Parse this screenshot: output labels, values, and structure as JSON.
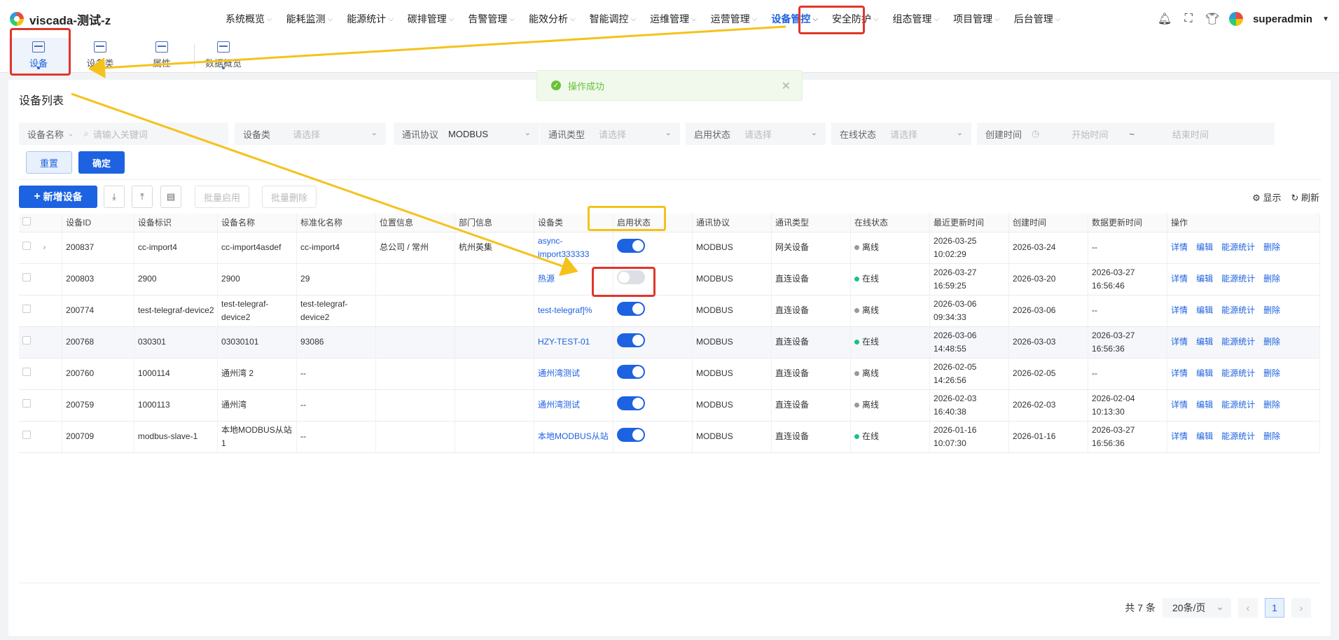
{
  "app": {
    "title": "viscada-测试-z",
    "user": "superadmin"
  },
  "menu": [
    {
      "label": "系统概览"
    },
    {
      "label": "能耗监测"
    },
    {
      "label": "能源统计"
    },
    {
      "label": "碳排管理"
    },
    {
      "label": "告警管理"
    },
    {
      "label": "能效分析"
    },
    {
      "label": "智能调控"
    },
    {
      "label": "运维管理"
    },
    {
      "label": "运营管理"
    },
    {
      "label": "设备管控"
    },
    {
      "label": "安全防护"
    },
    {
      "label": "组态管理"
    },
    {
      "label": "项目管理"
    },
    {
      "label": "后台管理"
    }
  ],
  "subnav": [
    {
      "label": "设备"
    },
    {
      "label": "设备类"
    },
    {
      "label": "属性"
    },
    {
      "label": "数据概览"
    }
  ],
  "toast": {
    "message": "操作成功"
  },
  "page": {
    "title": "设备列表"
  },
  "filters": {
    "name_label": "设备名称",
    "name_placeholder": "请输入关键词",
    "class_label": "设备类",
    "class_placeholder": "请选择",
    "protocol_label": "通讯协议",
    "protocol_value": "MODBUS",
    "commtype_label": "通讯类型",
    "commtype_placeholder": "请选择",
    "enable_label": "启用状态",
    "enable_placeholder": "请选择",
    "online_label": "在线状态",
    "online_placeholder": "请选择",
    "created_label": "创建时间",
    "start_placeholder": "开始时间",
    "range_sep": "~",
    "end_placeholder": "结束时间",
    "reset": "重置",
    "confirm": "确定"
  },
  "toolbar": {
    "add": "新增设备",
    "batch_enable": "批量启用",
    "batch_delete": "批量删除",
    "display": "显示",
    "refresh": "刷新"
  },
  "table": {
    "headers": [
      "设备ID",
      "设备标识",
      "设备名称",
      "标准化名称",
      "位置信息",
      "部门信息",
      "设备类",
      "启用状态",
      "通讯协议",
      "通讯类型",
      "在线状态",
      "最近更新时间",
      "创建时间",
      "数据更新时间",
      "操作"
    ],
    "ops": [
      "详情",
      "编辑",
      "能源统计",
      "删除"
    ],
    "rows": [
      {
        "id": "200837",
        "ident": "cc-import4",
        "name": "cc-import4asdef",
        "std": "cc-import4",
        "loc": "总公司 / 常州",
        "dept": "杭州英集",
        "cls": "async-import333333",
        "enabled": true,
        "protocol": "MODBUS",
        "ctype": "网关设备",
        "online": "离线",
        "updated": "2026-03-25 10:02:29",
        "created": "2026-03-24",
        "dataupd": "--"
      },
      {
        "id": "200803",
        "ident": "2900",
        "name": "2900",
        "std": "29",
        "loc": "",
        "dept": "",
        "cls": "热源",
        "enabled": false,
        "protocol": "MODBUS",
        "ctype": "直连设备",
        "online": "在线",
        "updated": "2026-03-27 16:59:25",
        "created": "2026-03-20",
        "dataupd": "2026-03-27 16:56:46"
      },
      {
        "id": "200774",
        "ident": "test-telegraf-device2",
        "name": "test-telegraf-device2",
        "std": "test-telegraf-device2",
        "loc": "",
        "dept": "",
        "cls": "test-telegraf]%",
        "enabled": true,
        "protocol": "MODBUS",
        "ctype": "直连设备",
        "online": "离线",
        "updated": "2026-03-06 09:34:33",
        "created": "2026-03-06",
        "dataupd": "--"
      },
      {
        "id": "200768",
        "ident": "030301",
        "name": "03030101",
        "std": "93086",
        "loc": "",
        "dept": "",
        "cls": "HZY-TEST-01",
        "enabled": true,
        "protocol": "MODBUS",
        "ctype": "直连设备",
        "online": "在线",
        "updated": "2026-03-06 14:48:55",
        "created": "2026-03-03",
        "dataupd": "2026-03-27 16:56:36"
      },
      {
        "id": "200760",
        "ident": "1000114",
        "name": "通州湾 2",
        "std": "--",
        "loc": "",
        "dept": "",
        "cls": "通州湾测试",
        "enabled": true,
        "protocol": "MODBUS",
        "ctype": "直连设备",
        "online": "离线",
        "updated": "2026-02-05 14:26:56",
        "created": "2026-02-05",
        "dataupd": "--"
      },
      {
        "id": "200759",
        "ident": "1000113",
        "name": "通州湾",
        "std": "--",
        "loc": "",
        "dept": "",
        "cls": "通州湾测试",
        "enabled": true,
        "protocol": "MODBUS",
        "ctype": "直连设备",
        "online": "离线",
        "updated": "2026-02-03 16:40:38",
        "created": "2026-02-03",
        "dataupd": "2026-02-04 10:13:30"
      },
      {
        "id": "200709",
        "ident": "modbus-slave-1",
        "name": "本地MODBUS从站1",
        "std": "--",
        "loc": "",
        "dept": "",
        "cls": "本地MODBUS从站",
        "enabled": true,
        "protocol": "MODBUS",
        "ctype": "直连设备",
        "online": "在线",
        "updated": "2026-01-16 10:07:30",
        "created": "2026-01-16",
        "dataupd": "2026-03-27 16:56:36"
      }
    ]
  },
  "pagination": {
    "total": "共 7 条",
    "page_size": "20条/页",
    "current": "1"
  },
  "colors": {
    "accent": "#1d62e0",
    "online": "#19c37d",
    "offline": "#999999",
    "annotation_red": "#e0362c",
    "annotation_yellow": "#f5c21b"
  }
}
